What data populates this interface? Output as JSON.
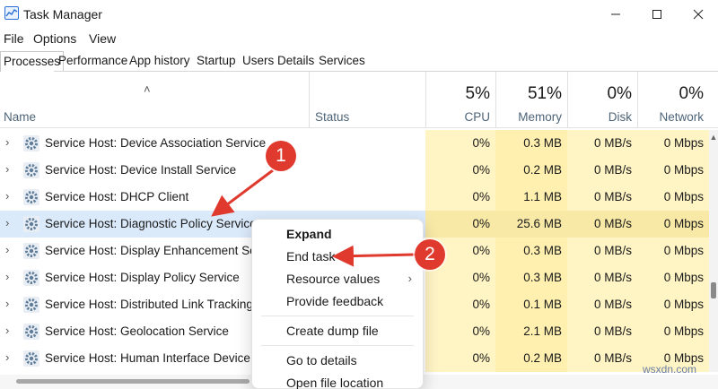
{
  "window": {
    "title": "Task Manager"
  },
  "menu": [
    "File",
    "Options",
    "View"
  ],
  "tabs": [
    "Processes",
    "Performance",
    "App history",
    "Startup",
    "Users",
    "Details",
    "Services"
  ],
  "columns": {
    "name": "Name",
    "status": "Status",
    "cpu": {
      "pct": "5%",
      "label": "CPU"
    },
    "memory": {
      "pct": "51%",
      "label": "Memory"
    },
    "disk": {
      "pct": "0%",
      "label": "Disk"
    },
    "network": {
      "pct": "0%",
      "label": "Network"
    }
  },
  "rows": [
    {
      "name": "Service Host: Device Association Service",
      "cpu": "0%",
      "memory": "0.3 MB",
      "disk": "0 MB/s",
      "network": "0 Mbps"
    },
    {
      "name": "Service Host: Device Install Service",
      "cpu": "0%",
      "memory": "0.2 MB",
      "disk": "0 MB/s",
      "network": "0 Mbps"
    },
    {
      "name": "Service Host: DHCP Client",
      "cpu": "0%",
      "memory": "1.1 MB",
      "disk": "0 MB/s",
      "network": "0 Mbps"
    },
    {
      "name": "Service Host: Diagnostic Policy Service",
      "cpu": "0%",
      "memory": "25.6 MB",
      "disk": "0 MB/s",
      "network": "0 Mbps"
    },
    {
      "name": "Service Host: Display Enhancement Servi",
      "cpu": "0%",
      "memory": "0.3 MB",
      "disk": "0 MB/s",
      "network": "0 Mbps"
    },
    {
      "name": "Service Host: Display Policy Service",
      "cpu": "0%",
      "memory": "0.3 MB",
      "disk": "0 MB/s",
      "network": "0 Mbps"
    },
    {
      "name": "Service Host: Distributed Link Tracking C",
      "cpu": "0%",
      "memory": "0.1 MB",
      "disk": "0 MB/s",
      "network": "0 Mbps"
    },
    {
      "name": "Service Host: Geolocation Service",
      "cpu": "0%",
      "memory": "2.1 MB",
      "disk": "0 MB/s",
      "network": "0 Mbps"
    },
    {
      "name": "Service Host: Human Interface Device Se",
      "cpu": "0%",
      "memory": "0.2 MB",
      "disk": "0 MB/s",
      "network": "0 Mbps"
    }
  ],
  "context_menu": {
    "expand": "Expand",
    "end_task": "End task",
    "resource_values": "Resource values",
    "provide_feedback": "Provide feedback",
    "create_dump": "Create dump file",
    "go_to_details": "Go to details",
    "open_file_location": "Open file location"
  },
  "callouts": [
    "1",
    "2"
  ],
  "watermark": "wsxdn.com",
  "colors": {
    "selected_row": "#dbeafb",
    "heat_cell": "#fff4c4",
    "callout": "#e0392e"
  },
  "icons": [
    "task-manager-icon",
    "gear-icon",
    "chevron-right-icon",
    "sort-up-icon"
  ]
}
